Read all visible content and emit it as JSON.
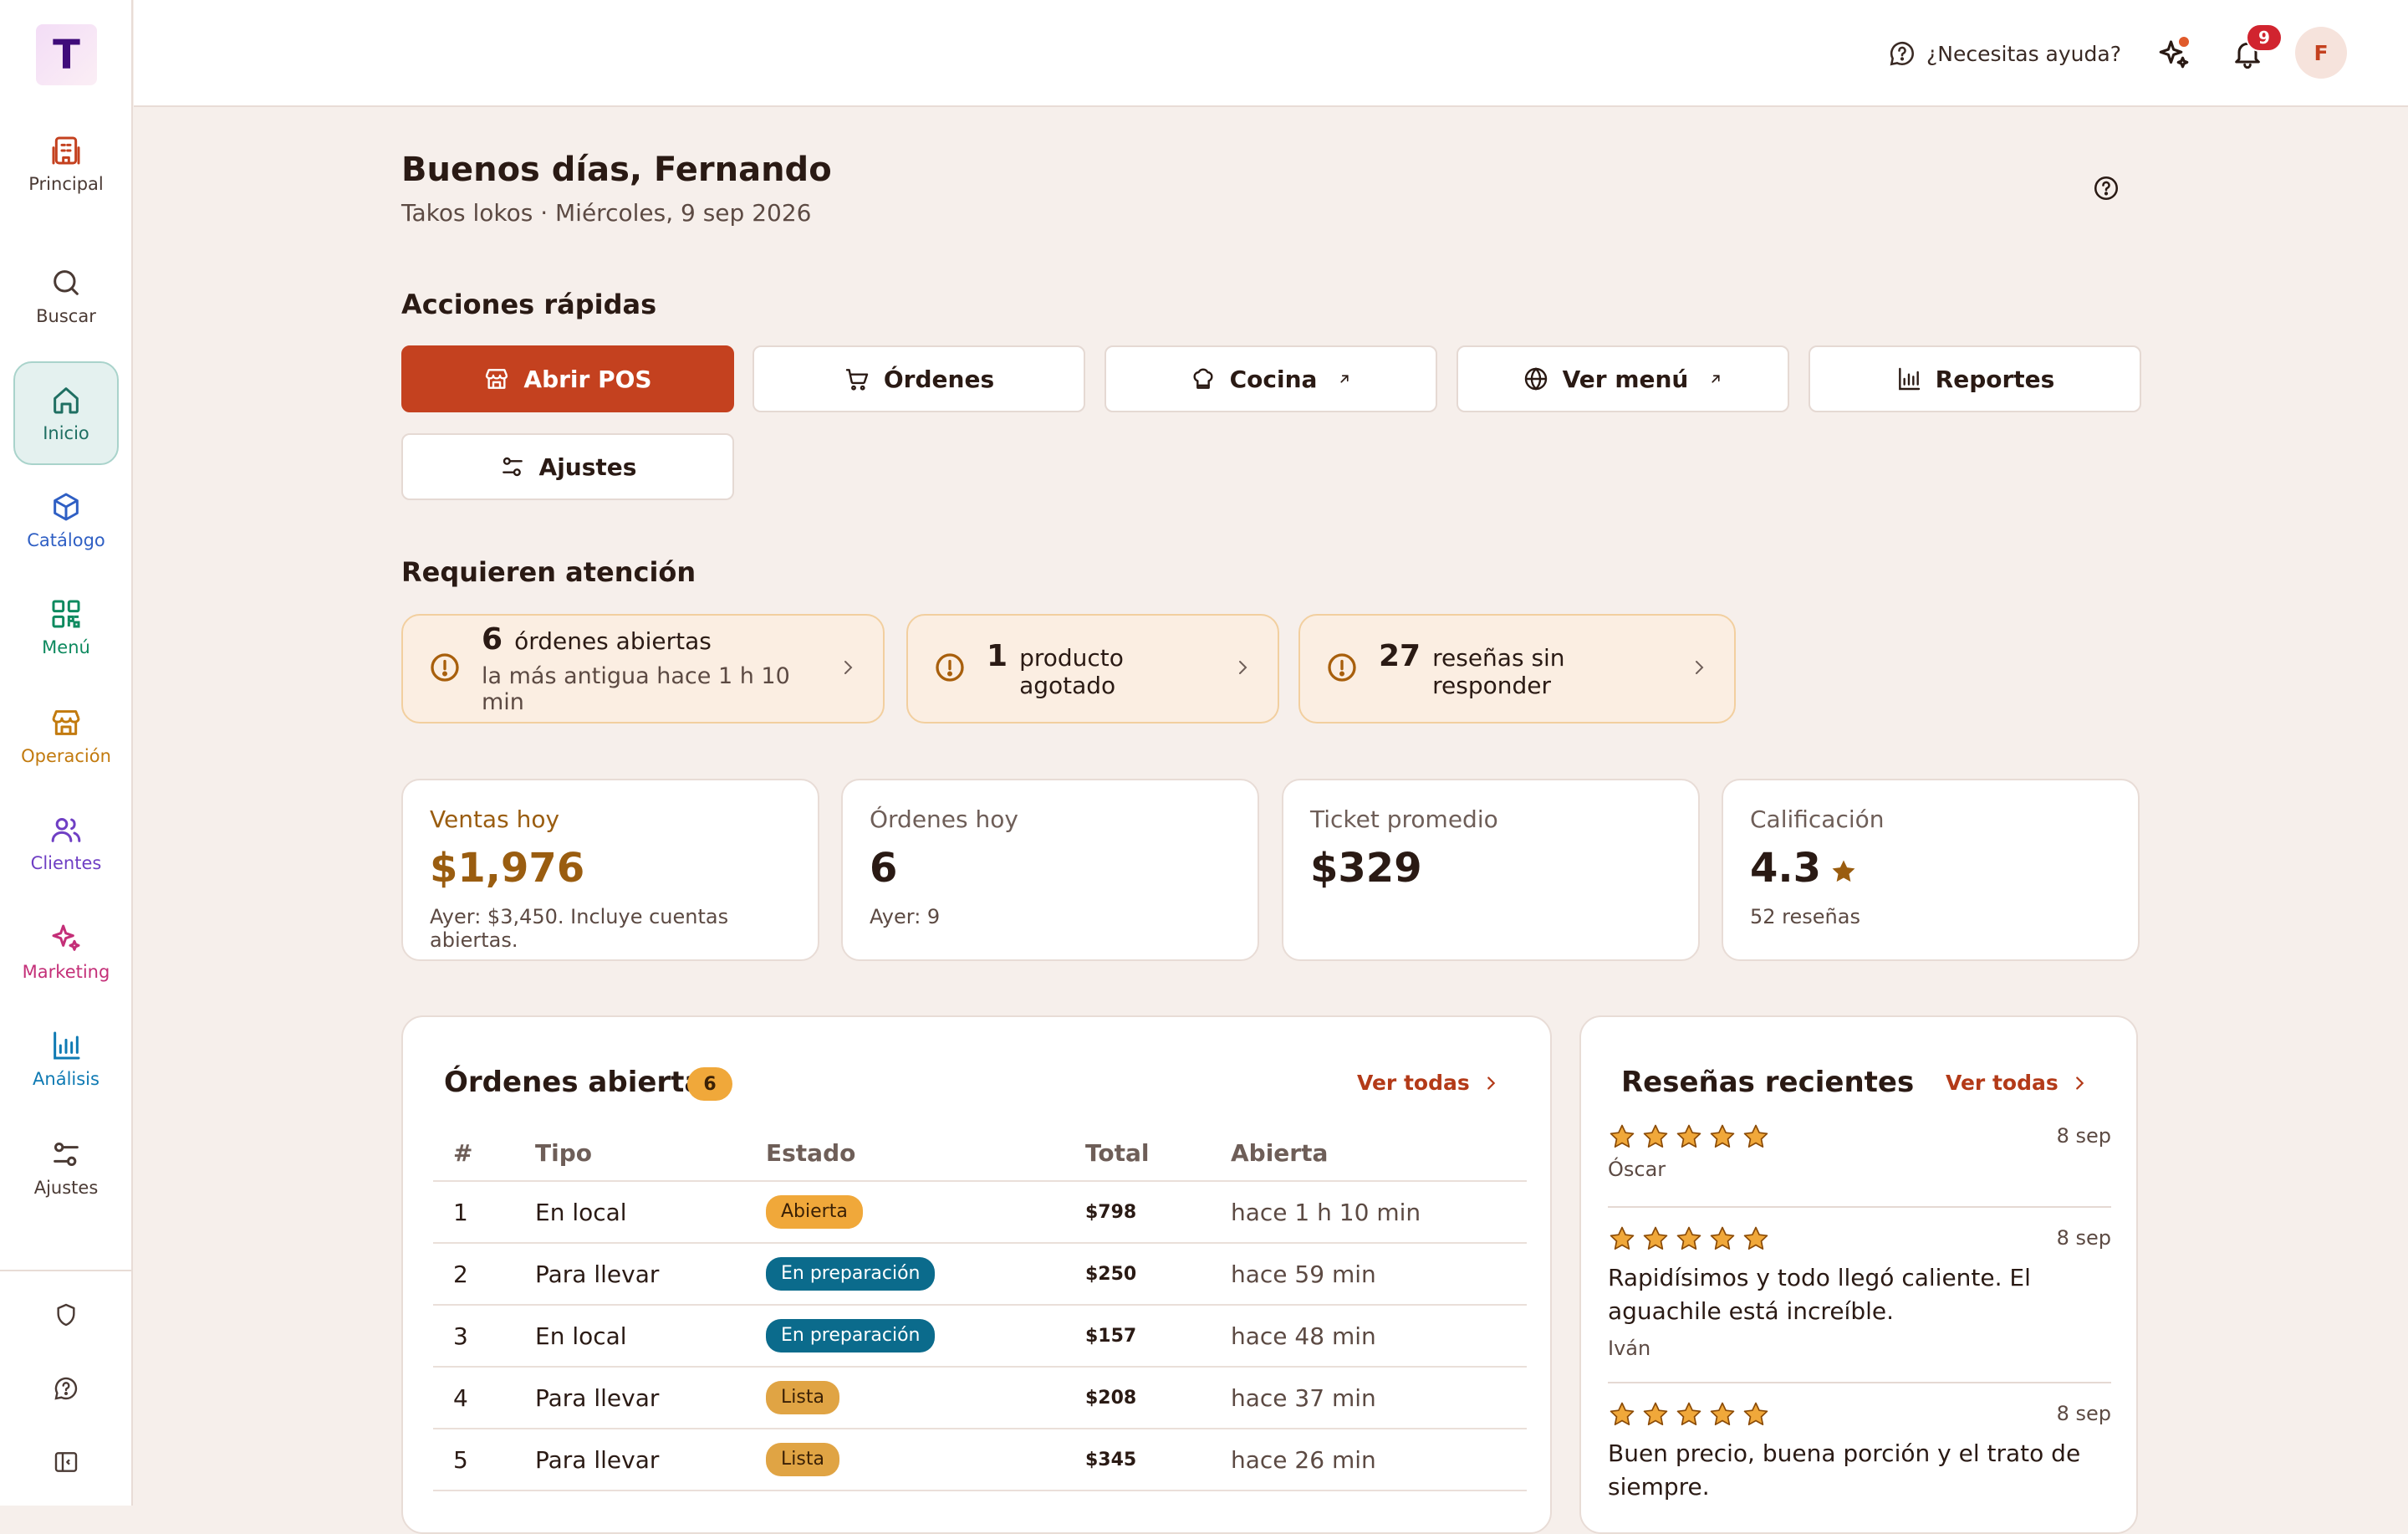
{
  "app": {
    "logo_letter": "T"
  },
  "sidebar": {
    "items": [
      {
        "label": "Principal",
        "icon": "building-icon",
        "color": "#c4411f"
      },
      {
        "label": "Buscar",
        "icon": "search-icon",
        "color": "#4a3a34"
      },
      {
        "label": "Inicio",
        "icon": "home-icon",
        "color": "#1f6f62",
        "active": true
      },
      {
        "label": "Catálogo",
        "icon": "box-icon",
        "color": "#2f5fc4"
      },
      {
        "label": "Menú",
        "icon": "qr-code-icon",
        "color": "#0e8a5f"
      },
      {
        "label": "Operación",
        "icon": "store-icon",
        "color": "#c27a0e"
      },
      {
        "label": "Clientes",
        "icon": "users-icon",
        "color": "#6f3fc4"
      },
      {
        "label": "Marketing",
        "icon": "sparkles-icon",
        "color": "#c42f78"
      },
      {
        "label": "Análisis",
        "icon": "bar-chart-icon",
        "color": "#0e7ab3"
      },
      {
        "label": "Ajustes",
        "icon": "sliders-icon",
        "color": "#4a3a34"
      }
    ],
    "bottom": [
      "shield-icon",
      "help-circle-icon",
      "collapse-sidebar-icon"
    ]
  },
  "header": {
    "help_label": "¿Necesitas ayuda?",
    "notifications_count": "9",
    "avatar_initial": "F"
  },
  "greeting": {
    "title": "Buenos días, Fernando",
    "subtitle": "Takos lokos · Miércoles, 9 sep 2026"
  },
  "quick_actions": {
    "title": "Acciones rápidas",
    "buttons": [
      {
        "label": "Abrir POS",
        "icon": "store-icon"
      },
      {
        "label": "Órdenes",
        "icon": "cart-icon"
      },
      {
        "label": "Cocina",
        "icon": "chef-hat-icon",
        "external": true
      },
      {
        "label": "Ver menú",
        "icon": "globe-icon",
        "external": true
      },
      {
        "label": "Reportes",
        "icon": "bar-chart-icon"
      },
      {
        "label": "Ajustes",
        "icon": "sliders-icon"
      }
    ]
  },
  "attention": {
    "title": "Requieren atención",
    "items": [
      {
        "count": "6",
        "label": "órdenes abiertas",
        "detail": "la más antigua hace 1 h 10 min"
      },
      {
        "count": "1",
        "label": "producto agotado"
      },
      {
        "count": "27",
        "label": "reseñas sin responder"
      }
    ]
  },
  "stats": [
    {
      "label": "Ventas hoy",
      "value": "$1,976",
      "sub": "Ayer: $3,450. Incluye cuentas abiertas."
    },
    {
      "label": "Órdenes hoy",
      "value": "6",
      "sub": "Ayer: 9"
    },
    {
      "label": "Ticket promedio",
      "value": "$329"
    },
    {
      "label": "Calificación",
      "value": "4.3",
      "sub": "52 reseñas"
    }
  ],
  "open_orders": {
    "title": "Órdenes abiertas",
    "count": "6",
    "see_all": "Ver todas",
    "columns": [
      "#",
      "Tipo",
      "Estado",
      "Total",
      "Abierta"
    ],
    "rows": [
      {
        "num": "1",
        "type": "En local",
        "status": "Abierta",
        "status_kind": "open",
        "total": "$798",
        "ago": "hace 1 h 10 min"
      },
      {
        "num": "2",
        "type": "Para llevar",
        "status": "En preparación",
        "status_kind": "prep",
        "total": "$250",
        "ago": "hace 59 min"
      },
      {
        "num": "3",
        "type": "En local",
        "status": "En preparación",
        "status_kind": "prep",
        "total": "$157",
        "ago": "hace 48 min"
      },
      {
        "num": "4",
        "type": "Para llevar",
        "status": "Lista",
        "status_kind": "ready",
        "total": "$208",
        "ago": "hace 37 min"
      },
      {
        "num": "5",
        "type": "Para llevar",
        "status": "Lista",
        "status_kind": "ready",
        "total": "$345",
        "ago": "hace 26 min"
      }
    ]
  },
  "reviews": {
    "title": "Reseñas recientes",
    "see_all": "Ver todas",
    "items": [
      {
        "stars": 5,
        "date": "8 sep",
        "text": "",
        "author": "Óscar"
      },
      {
        "stars": 5,
        "date": "8 sep",
        "text": "Rapidísimos y todo llegó caliente. El aguachile está increíble.",
        "author": "Iván"
      },
      {
        "stars": 5,
        "date": "8 sep",
        "text": "Buen precio, buena porción y el trato de siempre.",
        "author": ""
      }
    ]
  },
  "colors": {
    "brand": "#c4411f",
    "accent_gold": "#9a5d10",
    "star": "#f0a83a"
  }
}
